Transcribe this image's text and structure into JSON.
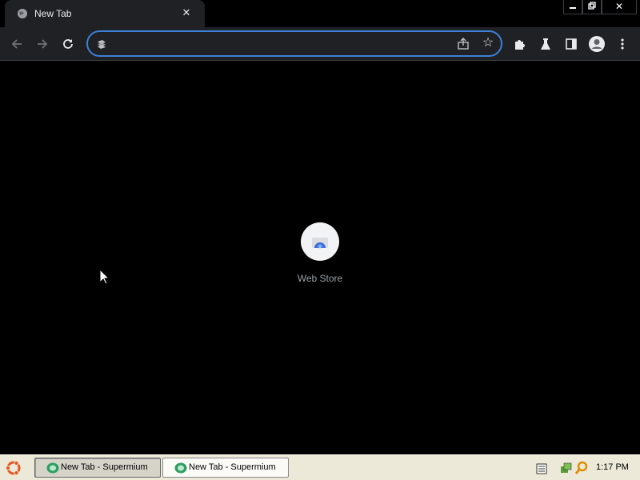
{
  "browser": {
    "tab": {
      "title": "New Tab",
      "favicon": "globe-icon",
      "close_icon": "close-icon"
    },
    "window_controls": {
      "minimize": "minimize-icon",
      "restore": "restore-icon",
      "close": "close-icon"
    },
    "toolbar": {
      "back_icon": "arrow-left-icon",
      "forward_icon": "arrow-right-icon",
      "reload_icon": "reload-icon",
      "extensions_icon": "puzzle-icon",
      "labs_icon": "flask-icon",
      "side_panel_icon": "side-panel-icon",
      "profile_icon": "avatar-icon",
      "menu_icon": "kebab-menu-icon"
    },
    "omnibox": {
      "value": "",
      "placeholder": "",
      "share_icon": "share-icon",
      "bookmark_icon": "star-icon"
    }
  },
  "new_tab_page": {
    "shortcuts": [
      {
        "label": "Web Store",
        "icon": "web-store-icon"
      }
    ]
  },
  "taskbar": {
    "start_icon": "ubuntu-logo-icon",
    "tasks": [
      {
        "label": "New Tab - Supermium",
        "active": true
      },
      {
        "label": "New Tab - Supermium",
        "active": false
      }
    ],
    "tray": [
      "keyboard-icon",
      "network-icon",
      "search-icon"
    ],
    "clock": "1:17 PM"
  },
  "colors": {
    "accent": "#3b82d8",
    "toolbar": "#202124",
    "background": "#000000",
    "taskbar": "#ece9d8"
  }
}
